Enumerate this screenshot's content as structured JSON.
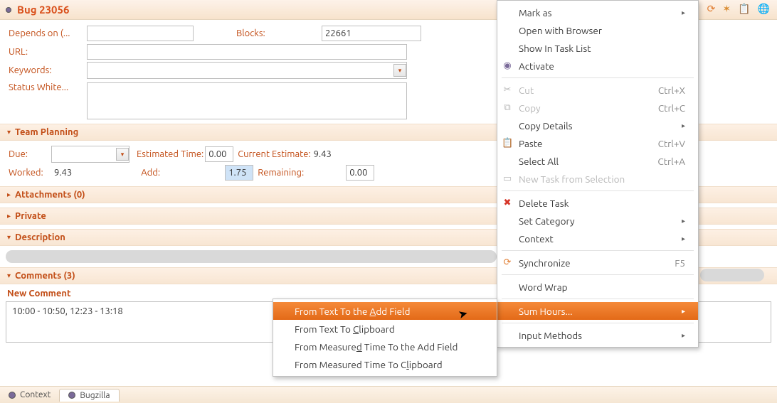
{
  "title": "Bug 23056",
  "toolbar_icons": {
    "sync": "⟳",
    "star": "✶",
    "clipboard": "📋",
    "globe": "🌐"
  },
  "fields": {
    "depends_on_label": "Depends on (...",
    "blocks_label": "Blocks:",
    "blocks_value": "22661",
    "url_label": "URL:",
    "keywords_label": "Keywords:",
    "status_white_label": "Status White..."
  },
  "sections": {
    "team_planning": "Team Planning",
    "attachments": "Attachments (0)",
    "private": "Private",
    "description": "Description",
    "comments": "Comments (3)"
  },
  "team": {
    "due_label": "Due:",
    "estimated_label": "Estimated Time:",
    "estimated_value": "0.00",
    "current_est_label": "Current Estimate:",
    "current_est_value": "9.43",
    "worked_label": "Worked:",
    "worked_value": "9.43",
    "add_label": "Add:",
    "add_value": "1.75",
    "remaining_label": "Remaining:",
    "remaining_value": "0.00"
  },
  "new_comment_label": "New Comment",
  "comment_text": "10:00 - 10:50, 12:23 - 13:18",
  "tabs": {
    "context": "Context",
    "bugzilla": "Bugzilla"
  },
  "menu_main": {
    "mark_as": "Mark as",
    "open_browser": "Open with Browser",
    "show_tasklist": "Show In Task List",
    "activate": "Activate",
    "cut": "Cut",
    "cut_key": "Ctrl+X",
    "copy": "Copy",
    "copy_key": "Ctrl+C",
    "copy_details": "Copy Details",
    "paste": "Paste",
    "paste_key": "Ctrl+V",
    "select_all": "Select All",
    "select_all_key": "Ctrl+A",
    "new_task": "New Task from Selection",
    "delete_task": "Delete Task",
    "set_category": "Set Category",
    "context": "Context",
    "synchronize": "Synchronize",
    "synchronize_key": "F5",
    "word_wrap": "Word Wrap",
    "sum_hours": "Sum Hours...",
    "input_methods": "Input Methods"
  },
  "menu_sub": {
    "from_text_add": "From Text To the Add Field",
    "from_text_clip": "From Text To Clipboard",
    "from_measured_add": "From Measured Time To the Add Field",
    "from_measured_clip": "From Measured Time To Clipboard"
  }
}
